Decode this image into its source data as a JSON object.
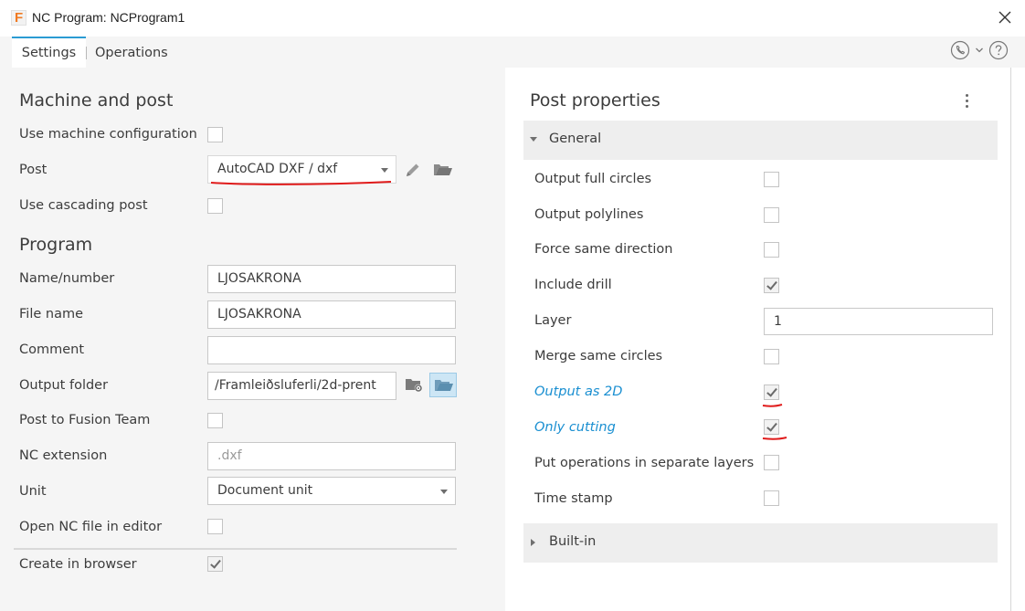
{
  "window": {
    "app_icon_letter": "F",
    "title": "NC Program: NCProgram1"
  },
  "tabs": [
    {
      "label": "Settings",
      "active": true
    },
    {
      "label": "Operations",
      "active": false
    }
  ],
  "icons": {
    "app": "fusion-app-icon",
    "close": "close-icon",
    "support": "phone-icon",
    "support_menu": "chevron-down-icon",
    "help": "help-icon",
    "edit_post": "pencil-icon",
    "open_post": "folder-open-icon",
    "folder_settings": "folder-gear-icon",
    "open_output": "folder-open-icon",
    "more": "more-vertical-icon"
  },
  "machine_and_post": {
    "title": "Machine and post",
    "use_machine_configuration": {
      "label": "Use machine configuration",
      "checked": false
    },
    "post": {
      "label": "Post",
      "value": "AutoCAD DXF / dxf"
    },
    "use_cascading_post": {
      "label": "Use cascading post",
      "checked": false
    }
  },
  "program": {
    "title": "Program",
    "name_number": {
      "label": "Name/number",
      "value": "LJOSAKRONA"
    },
    "file_name": {
      "label": "File name",
      "value": "LJOSAKRONA"
    },
    "comment": {
      "label": "Comment",
      "value": ""
    },
    "output_folder": {
      "label": "Output folder",
      "value": "/Framleiðsluferli/2d-prent"
    },
    "post_to_fusion_team": {
      "label": "Post to Fusion Team",
      "checked": false
    },
    "nc_extension": {
      "label": "NC extension",
      "placeholder": ".dxf"
    },
    "unit": {
      "label": "Unit",
      "value": "Document unit"
    },
    "open_nc_file_in_editor": {
      "label": "Open NC file in editor",
      "checked": false
    },
    "create_in_browser": {
      "label": "Create in browser",
      "checked": true
    }
  },
  "post_properties": {
    "title": "Post properties",
    "general": {
      "label": "General",
      "expanded": true,
      "rows": [
        {
          "label": "Output full circles",
          "type": "checkbox",
          "checked": false,
          "modified": false
        },
        {
          "label": "Output polylines",
          "type": "checkbox",
          "checked": false,
          "modified": false
        },
        {
          "label": "Force same direction",
          "type": "checkbox",
          "checked": false,
          "modified": false
        },
        {
          "label": "Include drill",
          "type": "checkbox",
          "checked": true,
          "modified": false
        },
        {
          "label": "Layer",
          "type": "text",
          "value": "1",
          "modified": false
        },
        {
          "label": "Merge same circles",
          "type": "checkbox",
          "checked": false,
          "modified": false
        },
        {
          "label": "Output as 2D",
          "type": "checkbox",
          "checked": true,
          "modified": true
        },
        {
          "label": "Only cutting",
          "type": "checkbox",
          "checked": true,
          "modified": true
        },
        {
          "label": "Put operations in separate layers",
          "type": "checkbox",
          "checked": false,
          "modified": false
        },
        {
          "label": "Time stamp",
          "type": "checkbox",
          "checked": false,
          "modified": false
        }
      ]
    },
    "built_in": {
      "label": "Built-in",
      "expanded": false
    }
  },
  "colors": {
    "accent": "#2b9bd3",
    "modified_text": "#1a8fd1",
    "annotation_red": "#e01b1b",
    "panel_bg": "#f5f5f5"
  }
}
